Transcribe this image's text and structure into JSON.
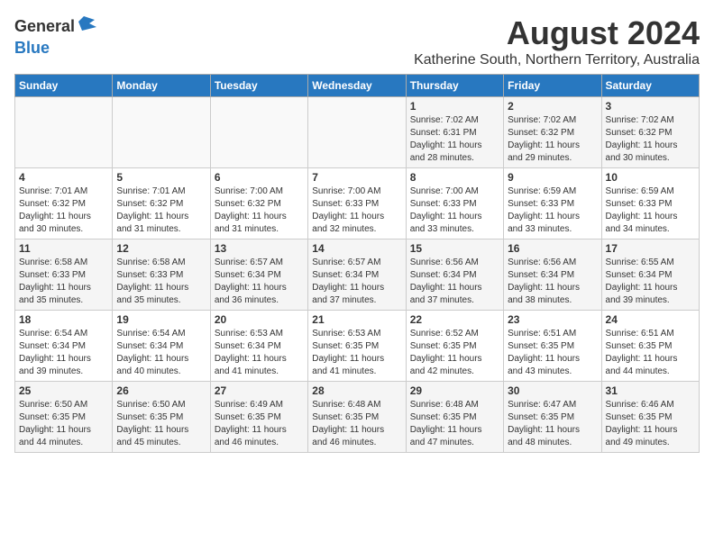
{
  "header": {
    "logo_general": "General",
    "logo_blue": "Blue",
    "main_title": "August 2024",
    "sub_title": "Katherine South, Northern Territory, Australia"
  },
  "calendar": {
    "days_of_week": [
      "Sunday",
      "Monday",
      "Tuesday",
      "Wednesday",
      "Thursday",
      "Friday",
      "Saturday"
    ],
    "weeks": [
      [
        {
          "day": "",
          "info": ""
        },
        {
          "day": "",
          "info": ""
        },
        {
          "day": "",
          "info": ""
        },
        {
          "day": "",
          "info": ""
        },
        {
          "day": "1",
          "info": "Sunrise: 7:02 AM\nSunset: 6:31 PM\nDaylight: 11 hours\nand 28 minutes."
        },
        {
          "day": "2",
          "info": "Sunrise: 7:02 AM\nSunset: 6:32 PM\nDaylight: 11 hours\nand 29 minutes."
        },
        {
          "day": "3",
          "info": "Sunrise: 7:02 AM\nSunset: 6:32 PM\nDaylight: 11 hours\nand 30 minutes."
        }
      ],
      [
        {
          "day": "4",
          "info": "Sunrise: 7:01 AM\nSunset: 6:32 PM\nDaylight: 11 hours\nand 30 minutes."
        },
        {
          "day": "5",
          "info": "Sunrise: 7:01 AM\nSunset: 6:32 PM\nDaylight: 11 hours\nand 31 minutes."
        },
        {
          "day": "6",
          "info": "Sunrise: 7:00 AM\nSunset: 6:32 PM\nDaylight: 11 hours\nand 31 minutes."
        },
        {
          "day": "7",
          "info": "Sunrise: 7:00 AM\nSunset: 6:33 PM\nDaylight: 11 hours\nand 32 minutes."
        },
        {
          "day": "8",
          "info": "Sunrise: 7:00 AM\nSunset: 6:33 PM\nDaylight: 11 hours\nand 33 minutes."
        },
        {
          "day": "9",
          "info": "Sunrise: 6:59 AM\nSunset: 6:33 PM\nDaylight: 11 hours\nand 33 minutes."
        },
        {
          "day": "10",
          "info": "Sunrise: 6:59 AM\nSunset: 6:33 PM\nDaylight: 11 hours\nand 34 minutes."
        }
      ],
      [
        {
          "day": "11",
          "info": "Sunrise: 6:58 AM\nSunset: 6:33 PM\nDaylight: 11 hours\nand 35 minutes."
        },
        {
          "day": "12",
          "info": "Sunrise: 6:58 AM\nSunset: 6:33 PM\nDaylight: 11 hours\nand 35 minutes."
        },
        {
          "day": "13",
          "info": "Sunrise: 6:57 AM\nSunset: 6:34 PM\nDaylight: 11 hours\nand 36 minutes."
        },
        {
          "day": "14",
          "info": "Sunrise: 6:57 AM\nSunset: 6:34 PM\nDaylight: 11 hours\nand 37 minutes."
        },
        {
          "day": "15",
          "info": "Sunrise: 6:56 AM\nSunset: 6:34 PM\nDaylight: 11 hours\nand 37 minutes."
        },
        {
          "day": "16",
          "info": "Sunrise: 6:56 AM\nSunset: 6:34 PM\nDaylight: 11 hours\nand 38 minutes."
        },
        {
          "day": "17",
          "info": "Sunrise: 6:55 AM\nSunset: 6:34 PM\nDaylight: 11 hours\nand 39 minutes."
        }
      ],
      [
        {
          "day": "18",
          "info": "Sunrise: 6:54 AM\nSunset: 6:34 PM\nDaylight: 11 hours\nand 39 minutes."
        },
        {
          "day": "19",
          "info": "Sunrise: 6:54 AM\nSunset: 6:34 PM\nDaylight: 11 hours\nand 40 minutes."
        },
        {
          "day": "20",
          "info": "Sunrise: 6:53 AM\nSunset: 6:34 PM\nDaylight: 11 hours\nand 41 minutes."
        },
        {
          "day": "21",
          "info": "Sunrise: 6:53 AM\nSunset: 6:35 PM\nDaylight: 11 hours\nand 41 minutes."
        },
        {
          "day": "22",
          "info": "Sunrise: 6:52 AM\nSunset: 6:35 PM\nDaylight: 11 hours\nand 42 minutes."
        },
        {
          "day": "23",
          "info": "Sunrise: 6:51 AM\nSunset: 6:35 PM\nDaylight: 11 hours\nand 43 minutes."
        },
        {
          "day": "24",
          "info": "Sunrise: 6:51 AM\nSunset: 6:35 PM\nDaylight: 11 hours\nand 44 minutes."
        }
      ],
      [
        {
          "day": "25",
          "info": "Sunrise: 6:50 AM\nSunset: 6:35 PM\nDaylight: 11 hours\nand 44 minutes."
        },
        {
          "day": "26",
          "info": "Sunrise: 6:50 AM\nSunset: 6:35 PM\nDaylight: 11 hours\nand 45 minutes."
        },
        {
          "day": "27",
          "info": "Sunrise: 6:49 AM\nSunset: 6:35 PM\nDaylight: 11 hours\nand 46 minutes."
        },
        {
          "day": "28",
          "info": "Sunrise: 6:48 AM\nSunset: 6:35 PM\nDaylight: 11 hours\nand 46 minutes."
        },
        {
          "day": "29",
          "info": "Sunrise: 6:48 AM\nSunset: 6:35 PM\nDaylight: 11 hours\nand 47 minutes."
        },
        {
          "day": "30",
          "info": "Sunrise: 6:47 AM\nSunset: 6:35 PM\nDaylight: 11 hours\nand 48 minutes."
        },
        {
          "day": "31",
          "info": "Sunrise: 6:46 AM\nSunset: 6:35 PM\nDaylight: 11 hours\nand 49 minutes."
        }
      ]
    ]
  }
}
